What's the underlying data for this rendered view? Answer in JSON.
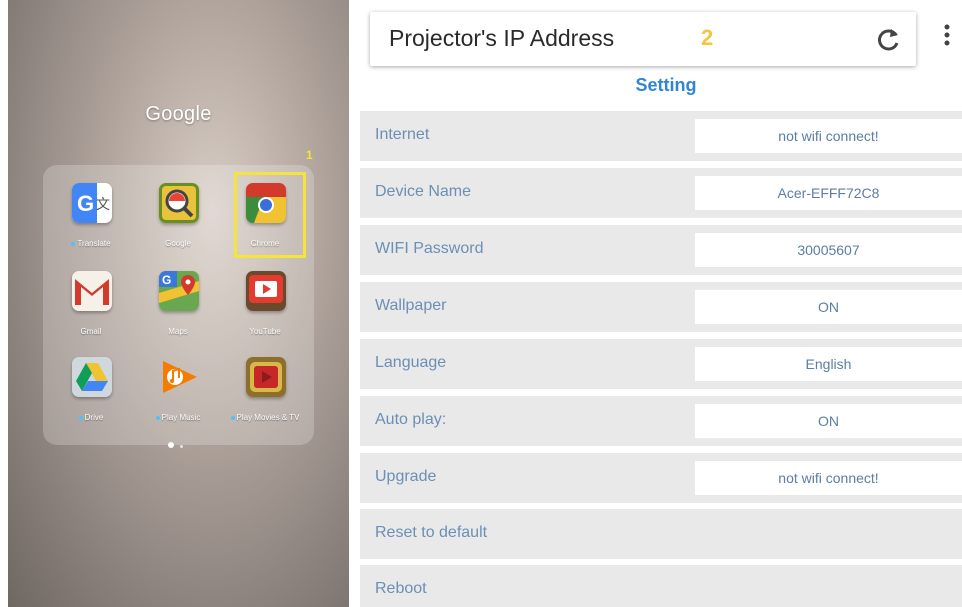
{
  "left_panel": {
    "folder_title": "Google",
    "marker": "1",
    "apps": [
      {
        "label": "Translate",
        "dot": true,
        "icon": "google-translate-icon"
      },
      {
        "label": "Google",
        "dot": false,
        "icon": "google-search-icon"
      },
      {
        "label": "Chrome",
        "dot": false,
        "icon": "chrome-icon"
      },
      {
        "label": "Gmail",
        "dot": false,
        "icon": "gmail-icon"
      },
      {
        "label": "Maps",
        "dot": false,
        "icon": "maps-icon"
      },
      {
        "label": "YouTube",
        "dot": false,
        "icon": "youtube-icon"
      },
      {
        "label": "Drive",
        "dot": true,
        "icon": "drive-icon"
      },
      {
        "label": "Play Music",
        "dot": true,
        "icon": "play-music-icon"
      },
      {
        "label": "Play Movies & TV",
        "dot": true,
        "icon": "play-movies-icon"
      }
    ]
  },
  "right_panel": {
    "title": "Projector's IP Address",
    "marker": "2",
    "icons": {
      "refresh": "refresh-icon",
      "menu": "more-vert-icon"
    },
    "heading": "Setting",
    "rows": [
      {
        "label": "Internet",
        "value": "not wifi connect!"
      },
      {
        "label": "Device Name",
        "value": "Acer-EFFF72C8"
      },
      {
        "label": "WIFI Password",
        "value": "30005607"
      },
      {
        "label": "Wallpaper",
        "value": "ON"
      },
      {
        "label": "Language",
        "value": "English"
      },
      {
        "label": "Auto play:",
        "value": "ON"
      },
      {
        "label": "Upgrade",
        "value": "not wifi connect!"
      },
      {
        "label": "Reset to default",
        "value": null
      },
      {
        "label": "Reboot",
        "value": null
      }
    ]
  },
  "colors": {
    "accent_blue": "#2f86d8",
    "marker_yellow": "#f5e43a",
    "row_bg": "#e9e9e9",
    "row_text": "#6b8fb5"
  }
}
